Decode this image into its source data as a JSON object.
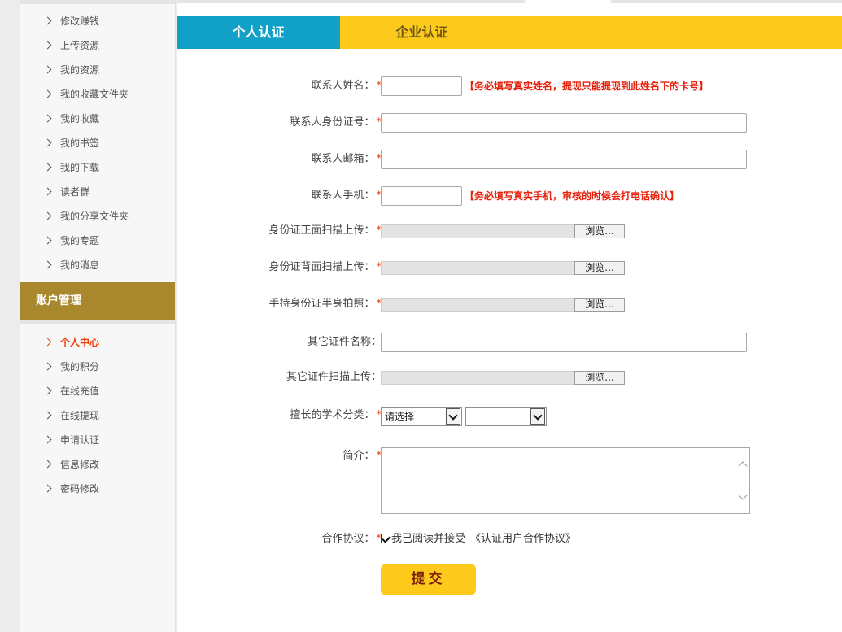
{
  "sidebar": {
    "list_a": [
      {
        "label": "修改赚钱"
      },
      {
        "label": "上传资源"
      },
      {
        "label": "我的资源"
      },
      {
        "label": "我的收藏文件夹"
      },
      {
        "label": "我的收藏"
      },
      {
        "label": "我的书签"
      },
      {
        "label": "我的下载"
      },
      {
        "label": "读者群"
      },
      {
        "label": "我的分享文件夹"
      },
      {
        "label": "我的专题"
      },
      {
        "label": "我的消息"
      }
    ],
    "section_title": "账户管理",
    "list_b": [
      {
        "label": "个人中心",
        "active": true
      },
      {
        "label": "我的积分"
      },
      {
        "label": "在线充值"
      },
      {
        "label": "在线提现"
      },
      {
        "label": "申请认证"
      },
      {
        "label": "信息修改"
      },
      {
        "label": "密码修改"
      }
    ]
  },
  "tabs": {
    "personal": "个人认证",
    "enterprise": "企业认证"
  },
  "form": {
    "required_mark": "*",
    "contact_name": {
      "label": "联系人姓名：",
      "value": "",
      "note": "【务必填写真实姓名，提现只能提现到此姓名下的卡号】"
    },
    "id_number": {
      "label": "联系人身份证号：",
      "value": ""
    },
    "email": {
      "label": "联系人邮箱：",
      "value": ""
    },
    "phone": {
      "label": "联系人手机：",
      "value": "",
      "note": "【务必填写真实手机，审核的时候会打电话确认】"
    },
    "id_front": {
      "label": "身份证正面扫描上传："
    },
    "id_back": {
      "label": "身份证背面扫描上传："
    },
    "id_hold": {
      "label": "手持身份证半身拍照："
    },
    "other_cert_name": {
      "label": "其它证件名称：",
      "value": ""
    },
    "other_cert_scan": {
      "label": "其它证件扫描上传："
    },
    "browse_label": "浏览...",
    "category": {
      "label": "擅长的学术分类：",
      "select1": "请选择",
      "select2": ""
    },
    "intro": {
      "label": "简介：",
      "value": ""
    },
    "agreement": {
      "label": "合作协议：",
      "checked": true,
      "text": "我已阅读并接受",
      "link": "《认证用户合作协议》"
    },
    "submit_label": "提交"
  }
}
